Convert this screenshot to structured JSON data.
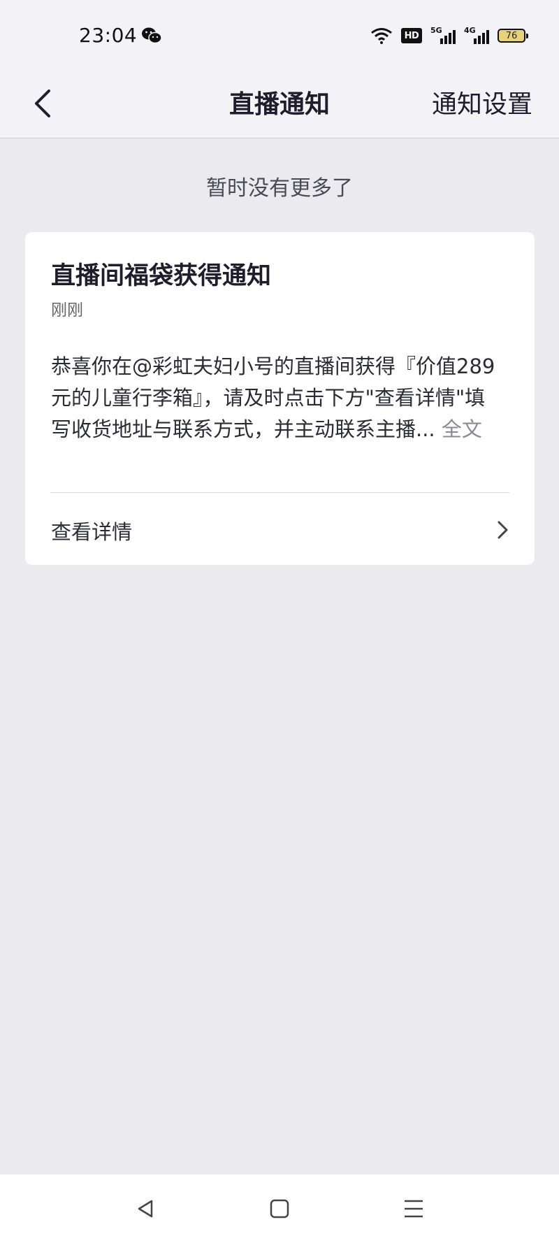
{
  "status_bar": {
    "time": "23:04",
    "hd_label": "HD",
    "signal1_label": "5G",
    "signal2_label": "4G",
    "battery": "76",
    "icons": [
      "wechat-icon",
      "wifi-icon",
      "hd-icon",
      "signal-5g-icon",
      "signal-4g-icon",
      "battery-icon"
    ]
  },
  "nav": {
    "title": "直播通知",
    "settings_label": "通知设置",
    "back_icon": "chevron-left-icon"
  },
  "list": {
    "no_more_text": "暂时没有更多了"
  },
  "notification": {
    "title": "直播间福袋获得通知",
    "time": "刚刚",
    "body_lines": [
      "恭喜你在@彩虹夫妇小号的直播间获得『价值289",
      "元的儿童行李箱』，请及时点击下方\"查看详情\"填",
      "写收货地址与联系方式，并主动联系主播..."
    ],
    "full_text_label": "全文",
    "action_label": "查看详情",
    "action_icon": "chevron-right-icon"
  },
  "bottom_nav": {
    "icons": [
      "back-triangle-icon",
      "home-square-icon",
      "menu-lines-icon"
    ]
  },
  "colors": {
    "background": "#ebeaef",
    "card": "#ffffff",
    "header": "#f3f3f7",
    "text_primary": "#1f1d2b",
    "text_secondary": "#666666"
  }
}
